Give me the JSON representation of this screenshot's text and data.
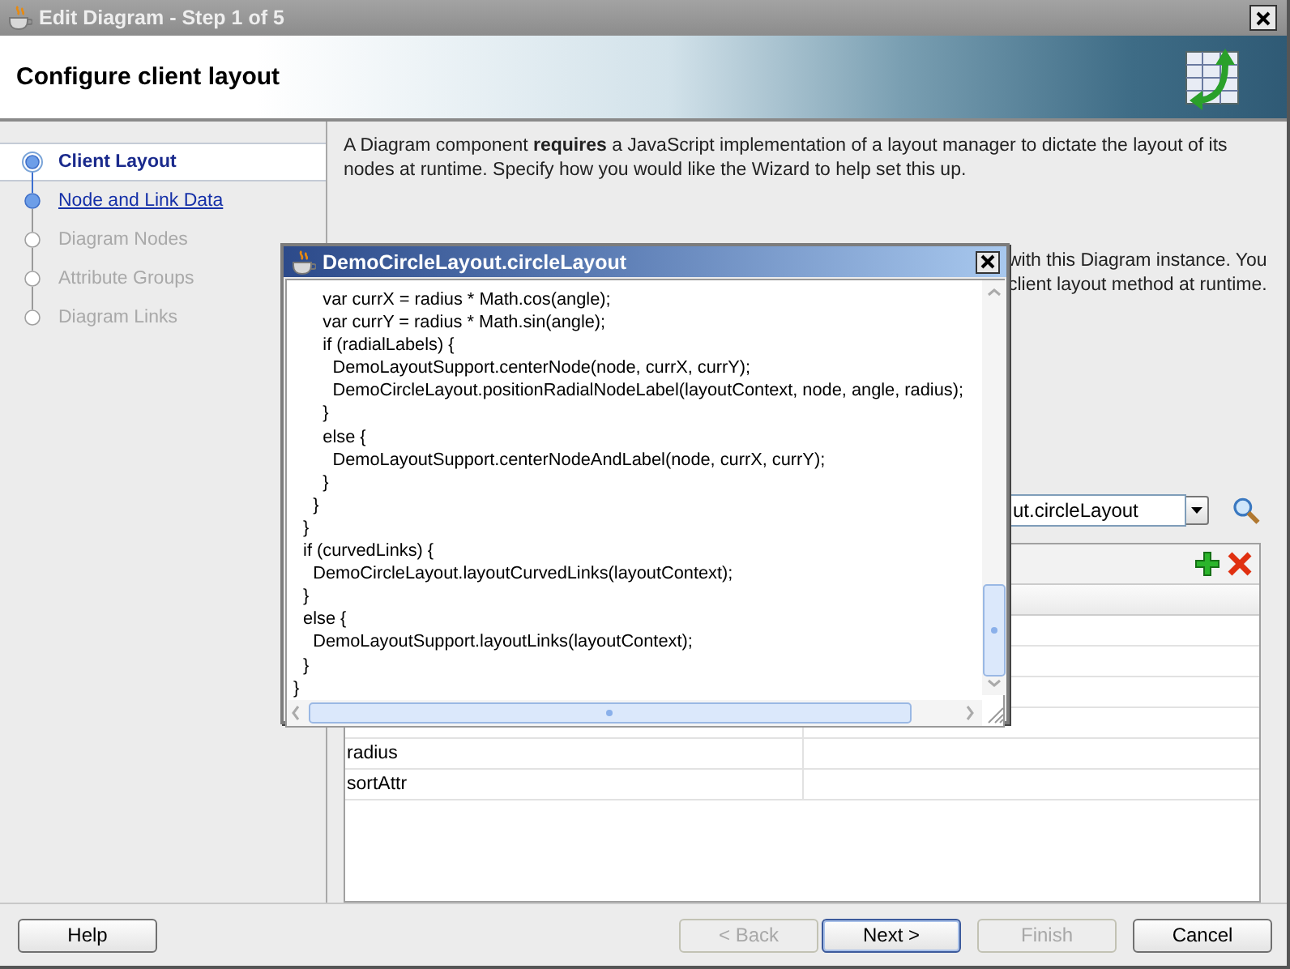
{
  "window": {
    "title": "Edit Diagram - Step 1 of 5"
  },
  "header": {
    "title": "Configure client layout"
  },
  "steps": [
    {
      "label": "Client Layout",
      "selected": true,
      "disabled": false
    },
    {
      "label": "Node and Link Data",
      "selected": false,
      "disabled": false
    },
    {
      "label": "Diagram Nodes",
      "selected": false,
      "disabled": true
    },
    {
      "label": "Attribute Groups",
      "selected": false,
      "disabled": true
    },
    {
      "label": "Diagram Links",
      "selected": false,
      "disabled": true
    }
  ],
  "description": "A Diagram component **requires** a JavaScript implementation of a layout manager to dictate the layout of its nodes at runtime. Specify how you would like the Wizard to help set this up.",
  "partial_note": [
    "with this Diagram instance. You",
    "client layout method at runtime."
  ],
  "layout_method": {
    "value": "ut.circleLayout"
  },
  "parameters": {
    "rows": [
      {
        "name": "radius"
      },
      {
        "name": "sortAttr"
      }
    ]
  },
  "popup": {
    "title": "DemoCircleLayout.circleLayout",
    "code": [
      "      var currX = radius * Math.cos(angle);",
      "      var currY = radius * Math.sin(angle);",
      "      if (radialLabels) {",
      "        DemoLayoutSupport.centerNode(node, currX, currY);",
      "        DemoCircleLayout.positionRadialNodeLabel(layoutContext, node, angle, radius);",
      "      }",
      "      else {",
      "        DemoLayoutSupport.centerNodeAndLabel(node, currX, currY);",
      "      }",
      "    }",
      "  }",
      "  if (curvedLinks) {",
      "    DemoCircleLayout.layoutCurvedLinks(layoutContext);",
      "  }",
      "  else {",
      "    DemoLayoutSupport.layoutLinks(layoutContext);",
      "  }",
      "}"
    ]
  },
  "buttons": [
    {
      "label": "Help",
      "disabled": false,
      "default": false
    },
    {
      "label": "< Back",
      "disabled": true,
      "default": false
    },
    {
      "label": "Next >",
      "disabled": false,
      "default": true
    },
    {
      "label": "Finish",
      "disabled": true,
      "default": false
    },
    {
      "label": "Cancel",
      "disabled": false,
      "default": false
    }
  ]
}
